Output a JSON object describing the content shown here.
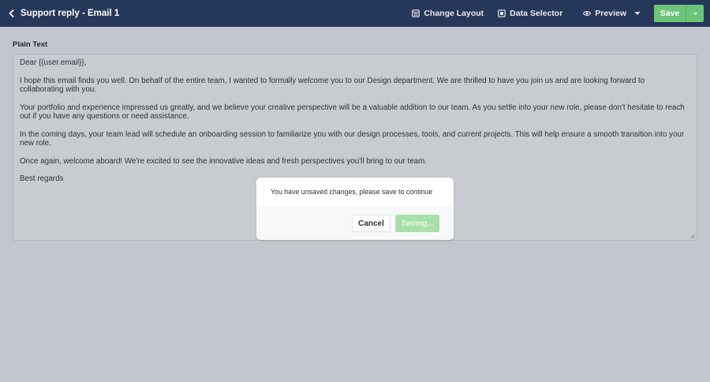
{
  "header": {
    "title": "Support reply - Email 1",
    "change_layout": "Change Layout",
    "data_selector": "Data Selector",
    "preview": "Preview",
    "save": "Save"
  },
  "editor": {
    "label": "Plain Text",
    "lines": [
      "Dear {{user.email}},",
      "I hope this email finds you well. On behalf of the entire team, I wanted to formally welcome you to our Design department. We are thrilled to have you join us and are looking forward to collaborating with you.",
      "Your portfolio and experience impressed us greatly, and we believe your creative perspective will be a valuable addition to our team. As you settle into your new role, please don't hesitate to reach out if you have any questions or need assistance.",
      "In the coming days, your team lead will schedule an onboarding session to familiarize you with our design processes, tools, and current projects. This will help ensure a smooth transition into your new role.",
      "Once again, welcome aboard! We're excited to see the innovative ideas and fresh perspectives you'll bring to our team.",
      "Best regards"
    ]
  },
  "modal": {
    "message": "You have unsaved changes, please save to continue",
    "cancel": "Cancel",
    "saving": "Saving..."
  },
  "colors": {
    "topbar": "#263859",
    "save_green": "#6cc578",
    "saving_green": "#a9dfa9",
    "overlay_bg": "#c3c6cc"
  },
  "icons": {
    "back": "chevron-left-icon",
    "change_layout": "layout-icon",
    "data_selector": "data-selector-icon",
    "preview": "eye-icon",
    "dropdown": "caret-down-icon"
  }
}
